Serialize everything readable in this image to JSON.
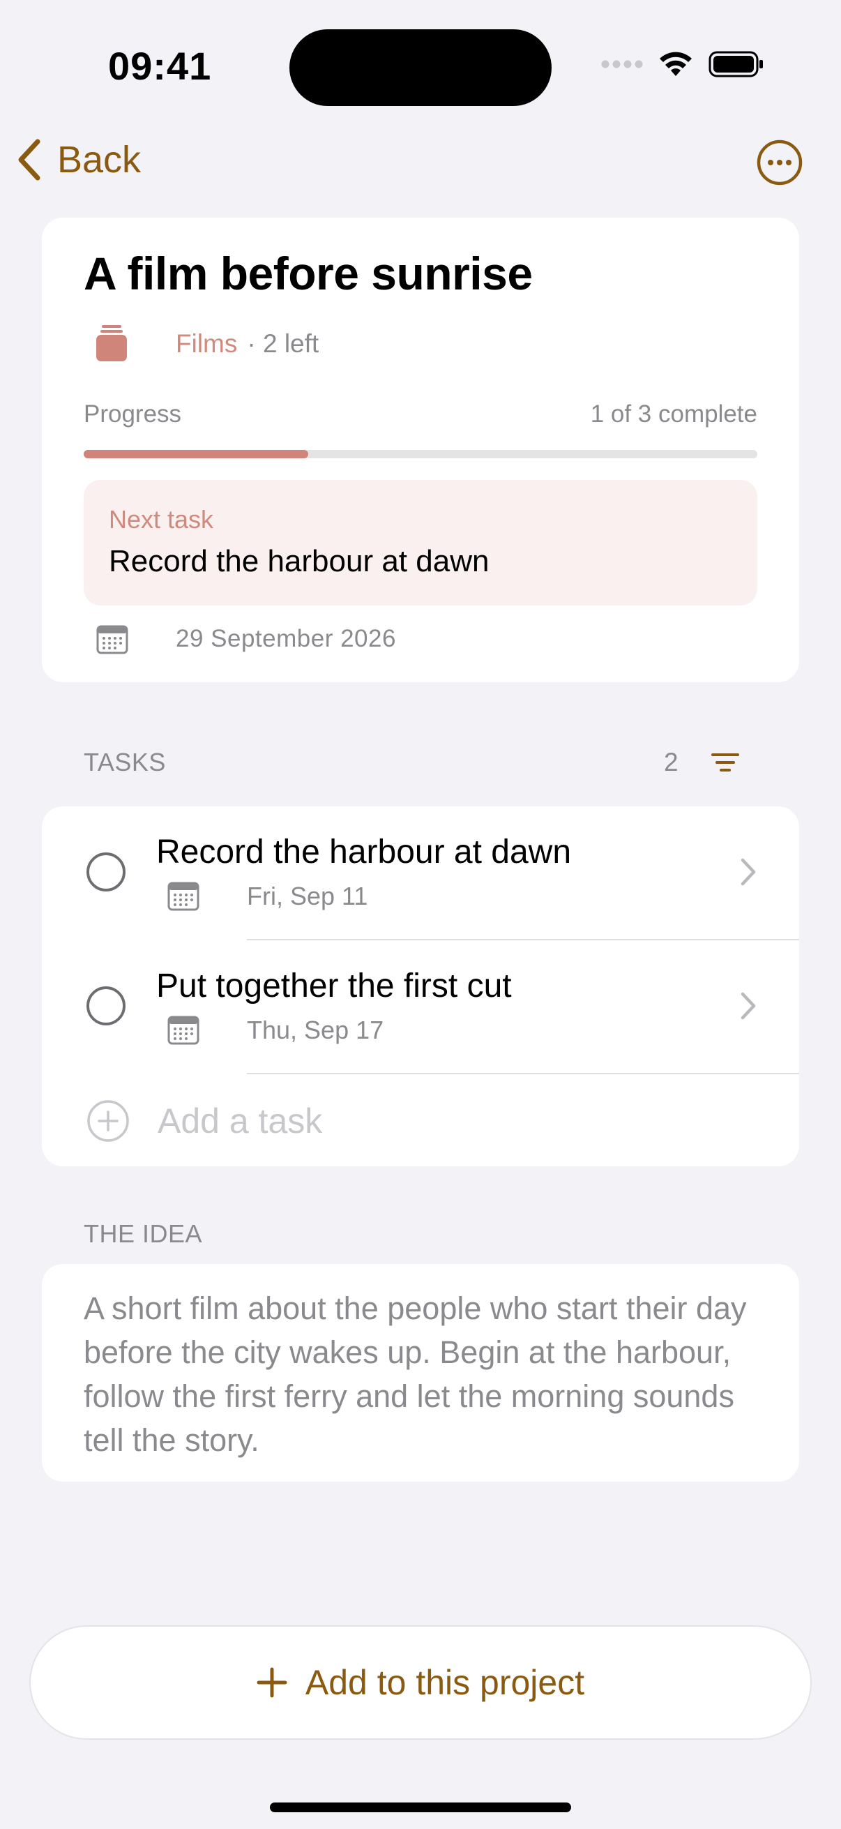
{
  "status_bar": {
    "time": "09:41"
  },
  "nav": {
    "back_label": "Back"
  },
  "project": {
    "title": "A film before sunrise",
    "category": "Films",
    "remaining": "· 2 left",
    "progress_label": "Progress",
    "progress_count": "1 of 3 complete",
    "progress_fraction": 0.333,
    "next_task_label": "Next task",
    "next_task_title": "Record the harbour at dawn",
    "date": "29 September 2026"
  },
  "tasks_section": {
    "header": "TASKS",
    "count": "2",
    "items": [
      {
        "title": "Record the harbour at dawn",
        "date": "Fri, Sep 11"
      },
      {
        "title": "Put together the first cut",
        "date": "Thu, Sep 17"
      }
    ],
    "add_placeholder": "Add a task"
  },
  "idea_section": {
    "header": "THE IDEA",
    "text": "A short film about the people who start their day before the city wakes up. Begin at the harbour, follow the first ferry and let the morning sounds tell the story."
  },
  "bottom_button": {
    "label": "Add to this project"
  },
  "colors": {
    "accent": "#8a5a10",
    "category": "#cf8a7e",
    "progress": "#cf857a"
  }
}
